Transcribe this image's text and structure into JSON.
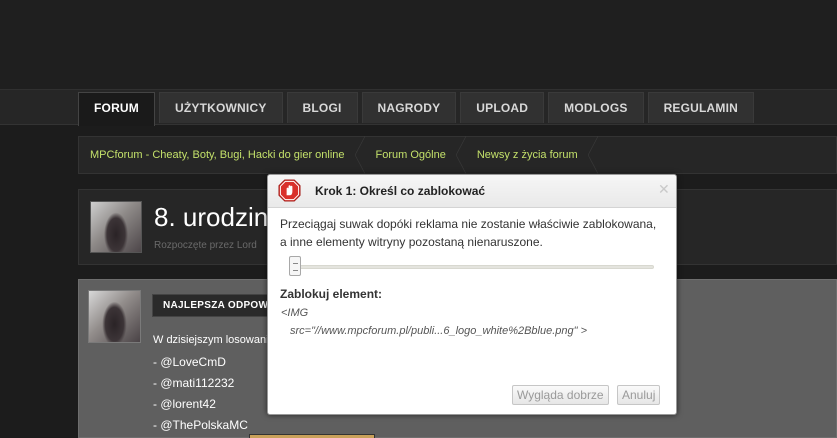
{
  "nav": {
    "tabs": [
      "FORUM",
      "UŻYTKOWNICY",
      "BLOGI",
      "NAGRODY",
      "UPLOAD",
      "MODLOGS",
      "REGULAMIN"
    ],
    "active": "FORUM"
  },
  "breadcrumb": [
    "MPCforum - Cheaty, Boty, Bugi, Hacki do gier online",
    "Forum Ogólne",
    "Newsy z życia forum"
  ],
  "topic": {
    "title": "8. urodzin",
    "meta": "Rozpoczęte przez Lord"
  },
  "post": {
    "best_answer_label": "NAJLEPSZA ODPOWI",
    "intro": "W dzisiejszym losowaniu",
    "mentions": [
      "- @LoveCmD",
      "- @mati112232",
      "- @lorent42",
      "- @ThePolskaMC"
    ]
  },
  "dialog": {
    "title": "Krok 1: Określ co zablokować",
    "instructions": "Przeciągaj suwak dopóki reklama nie zostanie właściwie zablokowana, a inne elementy witryny pozostaną nienaruszone.",
    "slider_level": 0,
    "block_label": "Zablokuj element:",
    "element_code_line1": "<IMG",
    "element_code_line2": "src=\"//www.mpcforum.pl/publi...6_logo_white%2Bblue.png\" >",
    "ok_button": "Wygląda dobrze",
    "cancel_button": "Anuluj",
    "close_icon": "close-icon",
    "stop_icon": "stop-sign-hand-icon"
  },
  "colors": {
    "breadcrumb_link": "#c3e06a",
    "stop_icon": "#d9302b"
  }
}
